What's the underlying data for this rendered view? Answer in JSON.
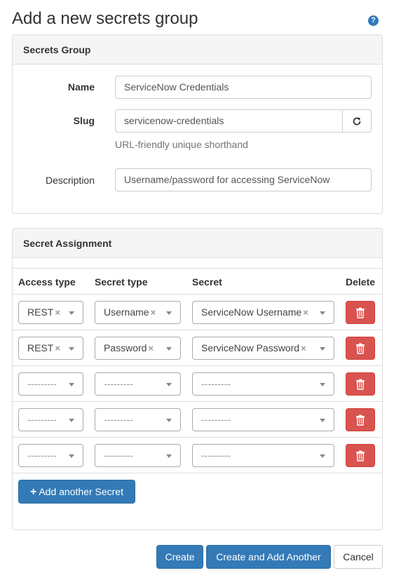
{
  "page": {
    "title": "Add a new secrets group",
    "help_icon": "question-circle-icon"
  },
  "secrets_group": {
    "heading": "Secrets Group",
    "name_label": "Name",
    "name_value": "ServiceNow Credentials",
    "slug_label": "Slug",
    "slug_value": "servicenow-credentials",
    "slug_help": "URL-friendly unique shorthand",
    "regenerate_icon": "refresh-icon",
    "description_label": "Description",
    "description_value": "Username/password for accessing ServiceNow"
  },
  "secret_assignment": {
    "heading": "Secret Assignment",
    "columns": [
      "Access type",
      "Secret type",
      "Secret",
      "Delete"
    ],
    "rows": [
      {
        "access_type": "REST",
        "secret_type": "Username",
        "secret": "ServiceNow Username"
      },
      {
        "access_type": "REST",
        "secret_type": "Password",
        "secret": "ServiceNow Password"
      },
      {
        "access_type": "---------",
        "secret_type": "---------",
        "secret": "---------"
      },
      {
        "access_type": "---------",
        "secret_type": "---------",
        "secret": "---------"
      },
      {
        "access_type": "---------",
        "secret_type": "---------",
        "secret": "---------"
      }
    ],
    "clear_symbol": "×",
    "add_button": "Add another Secret",
    "delete_color": "#d9534f"
  },
  "footer": {
    "create": "Create",
    "create_and_add": "Create and Add Another",
    "cancel": "Cancel"
  },
  "colors": {
    "primary": "#337ab7",
    "danger": "#d9534f",
    "help_icon": "#2f7bbf"
  }
}
